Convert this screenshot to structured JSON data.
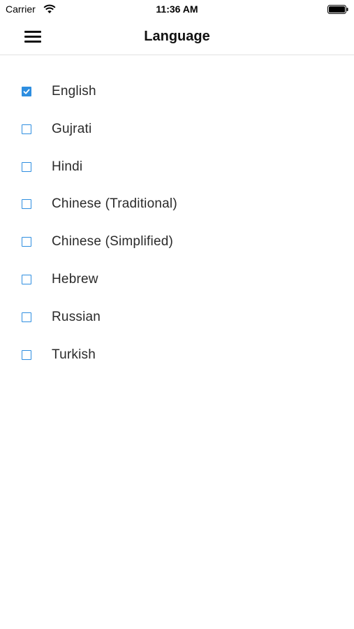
{
  "status_bar": {
    "carrier": "Carrier",
    "time": "11:36 AM",
    "wifi_icon": "wifi-icon",
    "battery_icon": "battery-icon"
  },
  "nav": {
    "title": "Language",
    "menu_icon": "hamburger-menu-icon"
  },
  "colors": {
    "accent": "#2e8ee0",
    "divider": "#e2e2e2"
  },
  "languages": [
    {
      "label": "English",
      "checked": true
    },
    {
      "label": "Gujrati",
      "checked": false
    },
    {
      "label": "Hindi",
      "checked": false
    },
    {
      "label": "Chinese (Traditional)",
      "checked": false
    },
    {
      "label": "Chinese (Simplified)",
      "checked": false
    },
    {
      "label": "Hebrew",
      "checked": false
    },
    {
      "label": "Russian",
      "checked": false
    },
    {
      "label": "Turkish",
      "checked": false
    }
  ]
}
